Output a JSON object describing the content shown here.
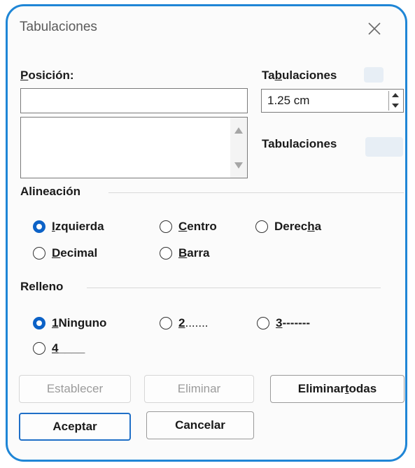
{
  "window": {
    "title": "Tabulaciones",
    "close_icon": "close-icon"
  },
  "position": {
    "label_before": "",
    "label_mnemonic": "P",
    "label_after": "osición:",
    "value": ""
  },
  "default_tabs": {
    "label_before": "Ta",
    "label_mnemonic": "b",
    "label_after": "ulaciones",
    "value": "1.25 cm"
  },
  "tabs_to_clear": {
    "label": "Tabulaciones"
  },
  "alignment": {
    "heading": "Alineación",
    "options": [
      {
        "before": "",
        "mnemonic": "I",
        "after": "zquierda",
        "selected": true
      },
      {
        "before": "",
        "mnemonic": "C",
        "after": "entro",
        "selected": false
      },
      {
        "before": "Derec",
        "mnemonic": "h",
        "after": "a",
        "selected": false
      },
      {
        "before": "",
        "mnemonic": "D",
        "after": "ecimal",
        "selected": false
      },
      {
        "before": "",
        "mnemonic": "B",
        "after": "arra",
        "selected": false
      }
    ]
  },
  "leader": {
    "heading": "Relleno",
    "options": [
      {
        "before": "",
        "mnemonic": "1",
        "after": " Ninguno",
        "selected": true
      },
      {
        "before": "",
        "mnemonic": "2",
        "after": " .......",
        "selected": false
      },
      {
        "before": "",
        "mnemonic": "3",
        "after": " -------",
        "selected": false
      },
      {
        "before": "",
        "mnemonic": "4",
        "after": " ____",
        "selected": false
      }
    ]
  },
  "buttons": {
    "set": "Establecer",
    "clear": "Eliminar",
    "clear_all_before": "Eliminar ",
    "clear_all_mnemonic": "t",
    "clear_all_after": "odas",
    "ok": "Aceptar",
    "cancel": "Cancelar"
  },
  "colors": {
    "accent": "#1f86d6",
    "radio_selected": "#0c62c7"
  }
}
